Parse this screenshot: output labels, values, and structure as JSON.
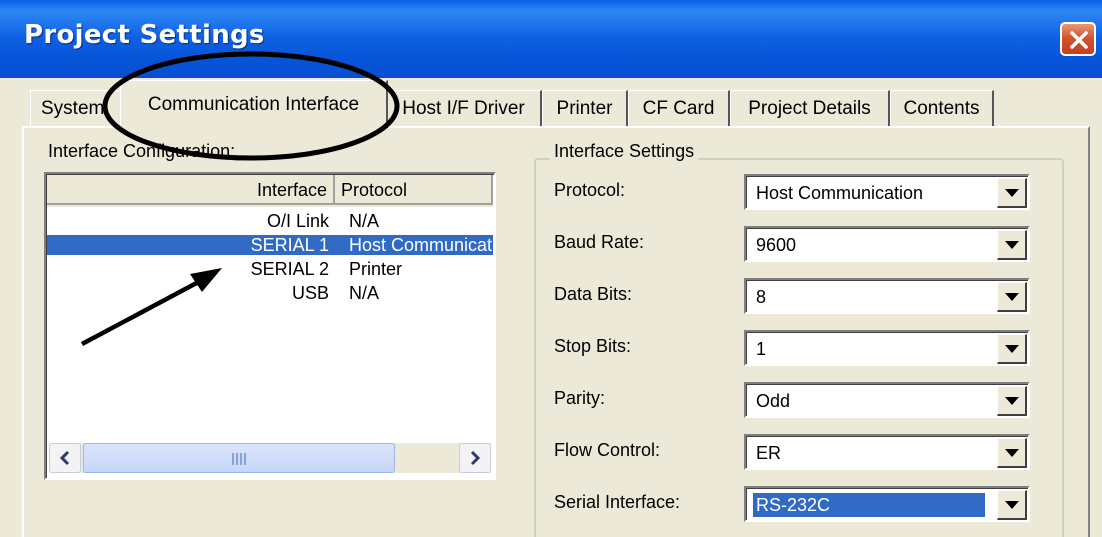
{
  "window": {
    "title": "Project Settings"
  },
  "tabs": [
    "System",
    "Communication Interface",
    "Host I/F Driver",
    "Printer",
    "CF Card",
    "Project Details",
    "Contents"
  ],
  "interface_config": {
    "label": "Interface Configuration:",
    "columns": [
      "Interface",
      "Protocol"
    ],
    "rows": [
      {
        "interface": "O/I Link",
        "protocol": "N/A"
      },
      {
        "interface": "SERIAL 1",
        "protocol": "Host Communication"
      },
      {
        "interface": "SERIAL 2",
        "protocol": "Printer"
      },
      {
        "interface": "USB",
        "protocol": "N/A"
      }
    ],
    "selected_row": 1
  },
  "interface_settings": {
    "label": "Interface Settings",
    "fields": [
      {
        "label": "Protocol:",
        "value": "Host Communication"
      },
      {
        "label": "Baud Rate:",
        "value": "9600"
      },
      {
        "label": "Data Bits:",
        "value": "8"
      },
      {
        "label": "Stop Bits:",
        "value": "1"
      },
      {
        "label": "Parity:",
        "value": "Odd"
      },
      {
        "label": "Flow Control:",
        "value": "ER"
      },
      {
        "label": "Serial Interface:",
        "value": "RS-232C"
      }
    ]
  },
  "colors": {
    "titlebar": "#0a5ee4",
    "selection": "#316ac5",
    "dialog": "#ece9d8",
    "close_button": "#d2552f"
  }
}
